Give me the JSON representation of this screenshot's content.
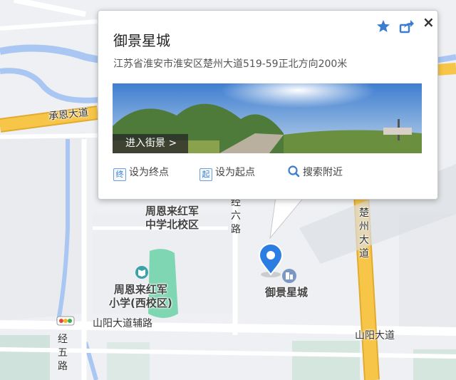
{
  "map": {
    "roads": {
      "chengen": "承恩大道",
      "jingliu": "经六路",
      "chuzhou": "楚州大道",
      "shanyang_fu": "山阳大道辅路",
      "shanyang": "山阳大道",
      "jingwu": "经五路"
    },
    "pois": {
      "zhou_middle_north": "周恩来红军\n中学北校区",
      "zhou_primary_west": "周恩来红军\n小学(西校区)",
      "marker_label": "御景星城"
    }
  },
  "popup": {
    "title": "御景星城",
    "address": "江苏省淮安市淮安区楚州大道519-59正北方向200米",
    "pano_button": "进入街景 >",
    "actions": {
      "set_end_icon": "终",
      "set_end": "设为终点",
      "set_start_icon": "起",
      "set_start": "设为起点",
      "search_nearby": "搜索附近"
    },
    "close": "×",
    "icons": {
      "favorite": "star-icon",
      "share": "share-icon",
      "search": "search-icon"
    },
    "colors": {
      "accent": "#3c7dd0",
      "marker": "#2b7de1",
      "major_road": "#f5c242"
    }
  }
}
